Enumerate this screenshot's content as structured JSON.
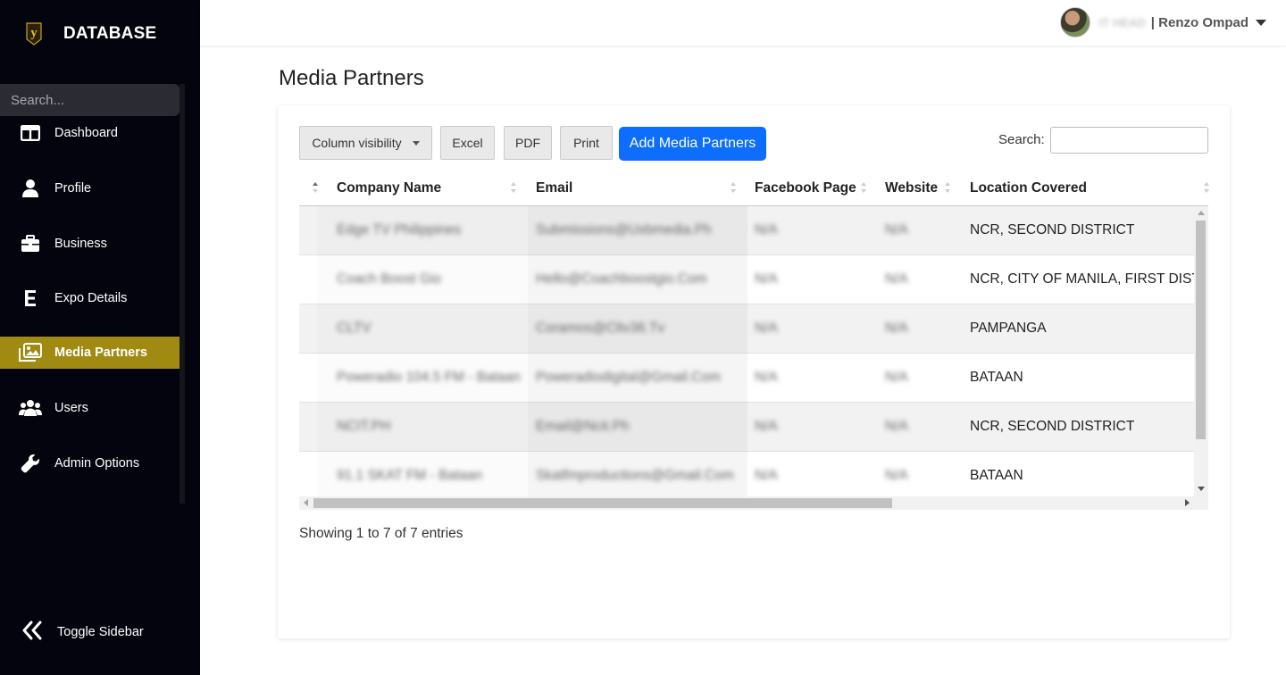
{
  "brand": {
    "name": "DATABASE",
    "logo_icon": "y-logo-icon"
  },
  "sidebar": {
    "search_placeholder": "Search...",
    "items": [
      {
        "label": "Dashboard",
        "icon": "columns-icon",
        "active": false
      },
      {
        "label": "Profile",
        "icon": "user-icon",
        "active": false
      },
      {
        "label": "Business",
        "icon": "briefcase-icon",
        "active": false
      },
      {
        "label": "Expo Details",
        "icon": "letter-e-icon",
        "active": false
      },
      {
        "label": "Media Partners",
        "icon": "images-icon",
        "active": true
      },
      {
        "label": "Users",
        "icon": "users-icon",
        "active": false
      },
      {
        "label": "Admin Options",
        "icon": "wrench-icon",
        "active": false
      }
    ],
    "toggle_label": "Toggle Sidebar",
    "active_color": "#a08a12"
  },
  "topbar": {
    "role": "IT HEAD",
    "user_name": "| Renzo Ompad"
  },
  "page": {
    "title": "Media Partners"
  },
  "toolbar": {
    "column_visibility": "Column visibility",
    "excel": "Excel",
    "pdf": "PDF",
    "print": "Print",
    "add": "Add Media Partners",
    "search_label": "Search:",
    "primary_color": "#0d6efd"
  },
  "table": {
    "columns": [
      "Company Name",
      "Email",
      "Facebook Page",
      "Website",
      "Location Covered"
    ],
    "rows": [
      {
        "company": "Edge TV Philippines",
        "email": "Submissions@Uxbmedia.Ph",
        "facebook": "N/A",
        "website": "N/A",
        "location": "NCR, SECOND DISTRICT"
      },
      {
        "company": "Coach Boost Gio",
        "email": "Hello@Coachboostgio.Com",
        "facebook": "N/A",
        "website": "N/A",
        "location": "NCR, CITY OF MANILA, FIRST DISTRICT"
      },
      {
        "company": "CLTV",
        "email": "Coramos@Cltv36.Tv",
        "facebook": "N/A",
        "website": "N/A",
        "location": "PAMPANGA"
      },
      {
        "company": "Poweradio 104.5 FM - Bataan",
        "email": "Poweradiodigital@Gmail.Com",
        "facebook": "N/A",
        "website": "N/A",
        "location": "BATAAN"
      },
      {
        "company": "NCIT.PH",
        "email": "Email@Ncit.Ph",
        "facebook": "N/A",
        "website": "N/A",
        "location": "NCR, SECOND DISTRICT"
      },
      {
        "company": "91.1 SKAT FM - Bataan",
        "email": "Skatfmproductions@Gmail.Com",
        "facebook": "N/A",
        "website": "N/A",
        "location": "BATAAN"
      }
    ],
    "info": "Showing 1 to 7 of 7 entries"
  }
}
